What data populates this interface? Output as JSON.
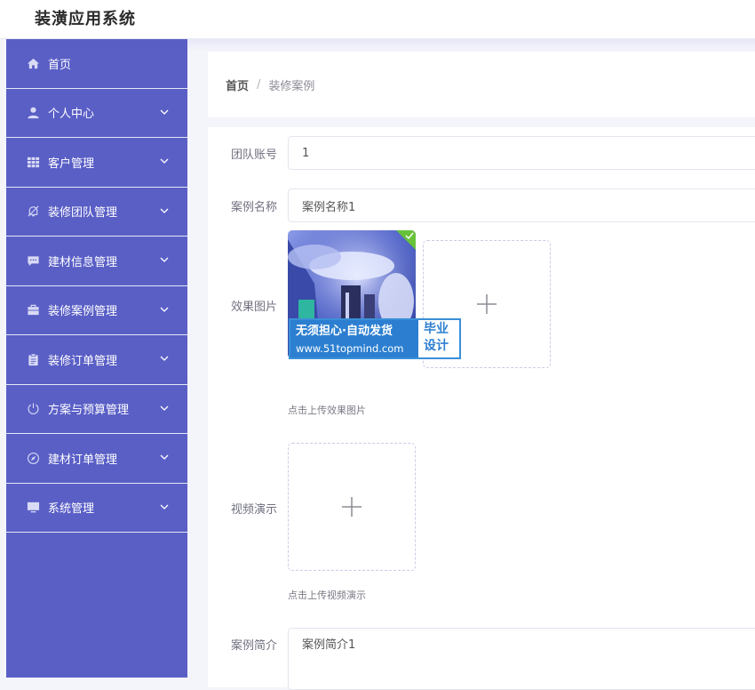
{
  "app": {
    "title": "装潢应用系统"
  },
  "sidebar": {
    "items": [
      {
        "label": "首页",
        "icon": "home-icon",
        "expandable": false
      },
      {
        "label": "个人中心",
        "icon": "user-icon",
        "expandable": true
      },
      {
        "label": "客户管理",
        "icon": "grid-icon",
        "expandable": true
      },
      {
        "label": "装修团队管理",
        "icon": "bell-off-icon",
        "expandable": true
      },
      {
        "label": "建材信息管理",
        "icon": "message-icon",
        "expandable": true
      },
      {
        "label": "装修案例管理",
        "icon": "briefcase-icon",
        "expandable": true
      },
      {
        "label": "装修订单管理",
        "icon": "clipboard-icon",
        "expandable": true
      },
      {
        "label": "方案与预算管理",
        "icon": "power-icon",
        "expandable": true
      },
      {
        "label": "建材订单管理",
        "icon": "compass-icon",
        "expandable": true
      },
      {
        "label": "系统管理",
        "icon": "monitor-icon",
        "expandable": true
      }
    ]
  },
  "breadcrumb": {
    "home": "首页",
    "separator": "/",
    "current": "装修案例"
  },
  "form": {
    "team_account": {
      "label": "团队账号",
      "value": "1"
    },
    "case_name": {
      "label": "案例名称",
      "value": "案例名称1"
    },
    "effect_image": {
      "label": "效果图片",
      "hint": "点击上传效果图片"
    },
    "video_demo": {
      "label": "视频演示",
      "hint": "点击上传视频演示"
    },
    "case_intro": {
      "label": "案例简介",
      "value": "案例简介1"
    }
  },
  "watermark": {
    "line1": "无须担心·自动发货",
    "line2": "www.51topmind.com",
    "side": "毕业设计"
  },
  "colors": {
    "sidebar": "#5a5fc6",
    "accent": "#2c7fd0",
    "success": "#67c23a"
  }
}
